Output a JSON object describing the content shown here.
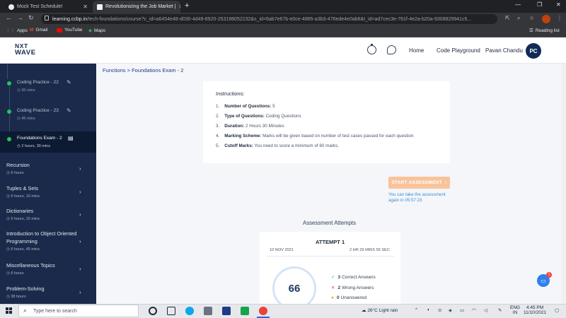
{
  "browser": {
    "tabs": [
      {
        "title": "Mock Test Schedule!",
        "active": false
      },
      {
        "title": "Revolutionizing the Job Market |",
        "active": true
      }
    ],
    "new_tab_icon": "plus-icon",
    "url_host": "learning.ccbp.in",
    "url_path": "/tech-foundations/course?c_id=a6454e48-d030-4d49-8920-253198052232&s_id=6ab7e67b-e0ce-4885-a3b3-476ede4e0ab6&t_id=ad7cec3e-761f-4e2a-b20a-9308829941c5...",
    "bookmarks": [
      "Apps",
      "Gmail",
      "YouTube",
      "Maps"
    ],
    "reading_list": "Reading list"
  },
  "app": {
    "logo_line1": "NXT",
    "logo_line2": "WAVE",
    "nav": {
      "home": "Home",
      "playground": "Code Playground",
      "user_name": "Pavan Chandu",
      "avatar_initials": "PC"
    }
  },
  "sidebar": {
    "sub_items": [
      {
        "title": "Coding Practice - 22",
        "duration": "30 mins"
      },
      {
        "title": "Coding Practice - 23",
        "duration": "45 mins"
      },
      {
        "title": "Foundations Exam - 2",
        "duration": "2 hours, 30 mins"
      }
    ],
    "sections": [
      {
        "title": "Recursion",
        "duration": "6 hours"
      },
      {
        "title": "Tuples & Sets",
        "duration": "5 hours, 10 mins"
      },
      {
        "title": "Dictionaries",
        "duration": "5 hours, 15 mins"
      },
      {
        "title": "Introduction to Object Oriented Programming",
        "duration": "6 hours, 45 mins"
      },
      {
        "title": "Miscellaneous Topics",
        "duration": "6 hours"
      },
      {
        "title": "Problem-Solving",
        "duration": "38 hours"
      }
    ]
  },
  "main": {
    "breadcrumb": "Functions > Foundations Exam - 2",
    "instructions_title": "Instructions:",
    "instructions": [
      {
        "num": "1.",
        "label": "Number of Questions:",
        "value": "5"
      },
      {
        "num": "2.",
        "label": "Type of Questions:",
        "value": "Coding Questions"
      },
      {
        "num": "3.",
        "label": "Duration:",
        "value": "2 Hours 30 Minutes"
      },
      {
        "num": "4.",
        "label": "Marking Scheme:",
        "value": "Marks will be given based on number of test cases passed for each question."
      },
      {
        "num": "5.",
        "label": "Cutoff Marks:",
        "value": "You need to score a minimum of 60 marks."
      }
    ],
    "start_button": "START ASSESSMENT",
    "retake_note": "You can take the assessment again in 05:57:23",
    "attempts_title": "Assessment Attempts",
    "attempt": {
      "label": "ATTEMPT 1",
      "date": "10 NOV 2021",
      "duration": "2 HR 29 MINS 55 SEC",
      "score": "66",
      "correct_count": "3",
      "correct_label": "Correct Answers",
      "wrong_count": "2",
      "wrong_label": "Wrong Answers",
      "unanswered_count": "0",
      "unanswered_label": "Unanswered"
    },
    "chat_badge": "1"
  },
  "taskbar": {
    "search_placeholder": "Type here to search",
    "weather": "26°C  Light rain",
    "lang1": "ENG",
    "lang2": "IN",
    "time": "4:45 PM",
    "date": "11/10/2021"
  },
  "colors": {
    "sidebar_bg": "#1b2a4a",
    "accent_orange": "#f8c39a",
    "link_blue": "#1e3a8a",
    "avatar_bg": "#0f2c59"
  }
}
